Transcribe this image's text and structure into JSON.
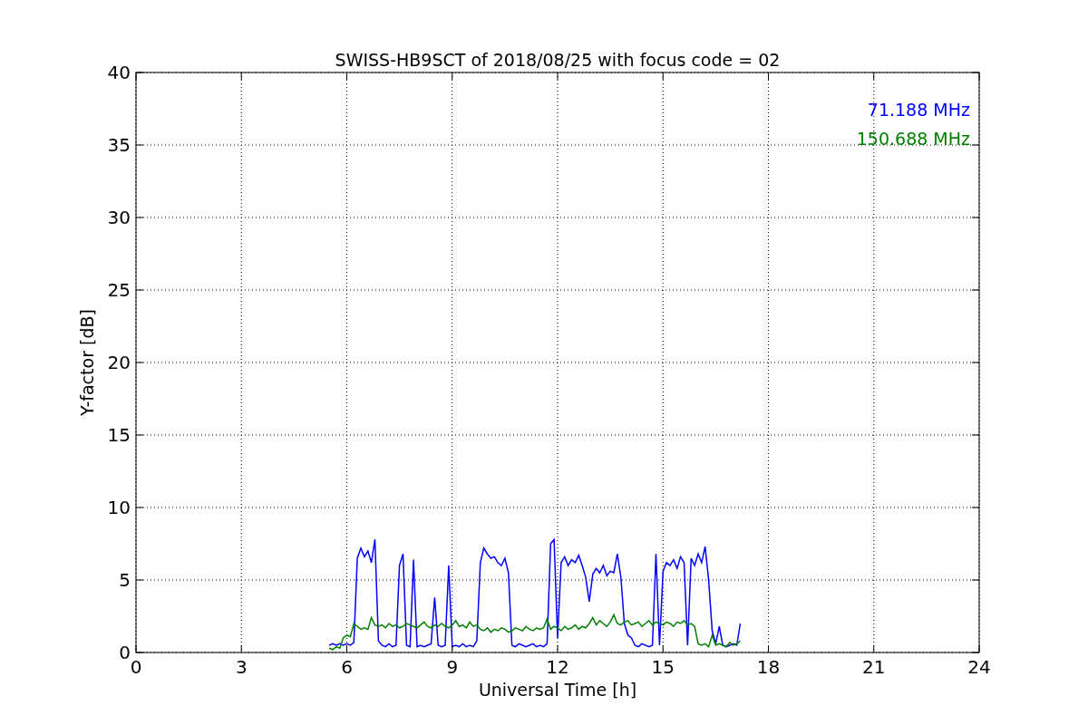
{
  "figure": {
    "chart_data": {
      "type": "line",
      "title": "SWISS-HB9SCT of 2018/08/25 with focus code = 02",
      "xlabel": "Universal Time [h]",
      "ylabel": "Y-factor [dB]",
      "xlim": [
        0,
        24
      ],
      "ylim": [
        0,
        40
      ],
      "xticks": [
        0,
        3,
        6,
        9,
        12,
        15,
        18,
        21,
        24
      ],
      "yticks": [
        0,
        5,
        10,
        15,
        20,
        25,
        30,
        35,
        40
      ],
      "grid": true,
      "x": [
        5.5,
        5.6,
        5.7,
        5.8,
        5.9,
        6.0,
        6.1,
        6.2,
        6.3,
        6.4,
        6.5,
        6.6,
        6.7,
        6.8,
        6.9,
        7.0,
        7.1,
        7.2,
        7.3,
        7.4,
        7.5,
        7.6,
        7.7,
        7.8,
        7.9,
        8.0,
        8.1,
        8.2,
        8.3,
        8.4,
        8.5,
        8.6,
        8.7,
        8.8,
        8.9,
        9.0,
        9.1,
        9.2,
        9.3,
        9.4,
        9.5,
        9.6,
        9.7,
        9.8,
        9.9,
        10.0,
        10.1,
        10.2,
        10.3,
        10.4,
        10.5,
        10.6,
        10.7,
        10.8,
        10.9,
        11.0,
        11.1,
        11.2,
        11.3,
        11.4,
        11.5,
        11.6,
        11.7,
        11.8,
        11.9,
        12.0,
        12.1,
        12.2,
        12.3,
        12.4,
        12.5,
        12.6,
        12.7,
        12.8,
        12.9,
        13.0,
        13.1,
        13.2,
        13.3,
        13.4,
        13.5,
        13.6,
        13.7,
        13.8,
        13.9,
        14.0,
        14.1,
        14.2,
        14.3,
        14.4,
        14.5,
        14.6,
        14.7,
        14.8,
        14.9,
        15.0,
        15.1,
        15.2,
        15.3,
        15.4,
        15.5,
        15.6,
        15.7,
        15.8,
        15.9,
        16.0,
        16.1,
        16.2,
        16.3,
        16.4,
        16.5,
        16.6,
        16.7,
        16.8,
        16.9,
        17.0,
        17.1,
        17.2
      ],
      "series": [
        {
          "name": "71.188 MHz",
          "color": "#0000ff",
          "values": [
            0.5,
            0.6,
            0.5,
            0.6,
            0.5,
            0.6,
            0.5,
            0.7,
            6.5,
            7.2,
            6.6,
            7.0,
            6.2,
            7.8,
            0.8,
            0.5,
            0.4,
            0.6,
            0.4,
            0.5,
            6.0,
            6.8,
            0.5,
            0.4,
            6.4,
            0.4,
            0.5,
            0.4,
            0.5,
            0.6,
            3.8,
            0.5,
            0.4,
            0.5,
            6.0,
            0.4,
            0.5,
            0.4,
            0.6,
            0.4,
            0.5,
            0.4,
            0.8,
            6.2,
            7.2,
            6.8,
            6.5,
            6.6,
            6.2,
            6.0,
            6.5,
            5.5,
            0.5,
            0.4,
            0.6,
            0.5,
            0.4,
            0.5,
            0.6,
            0.4,
            0.5,
            0.4,
            0.6,
            7.5,
            7.8,
            1.0,
            6.2,
            6.6,
            6.0,
            6.4,
            6.2,
            6.7,
            6.0,
            5.2,
            3.5,
            5.4,
            5.8,
            5.5,
            6.0,
            5.3,
            5.6,
            5.5,
            6.8,
            5.2,
            2.0,
            1.2,
            1.0,
            0.5,
            0.4,
            0.6,
            0.5,
            0.4,
            0.5,
            6.8,
            0.5,
            5.6,
            6.2,
            6.0,
            6.4,
            5.8,
            6.6,
            6.2,
            0.5,
            6.5,
            6.0,
            6.8,
            6.2,
            7.3,
            5.0,
            1.5,
            0.6,
            1.8,
            0.5,
            0.4,
            0.5,
            0.6,
            0.5,
            2.0
          ]
        },
        {
          "name": "150.688 MHz",
          "color": "#008000",
          "values": [
            0.3,
            0.2,
            0.4,
            0.3,
            1.0,
            1.2,
            1.1,
            2.0,
            1.8,
            1.6,
            1.7,
            1.6,
            2.4,
            1.9,
            1.8,
            1.9,
            1.7,
            2.0,
            1.8,
            1.9,
            1.7,
            1.8,
            2.0,
            1.9,
            1.8,
            1.7,
            1.9,
            2.1,
            1.8,
            1.7,
            1.9,
            1.8,
            2.0,
            1.8,
            1.7,
            1.9,
            2.2,
            1.8,
            1.9,
            1.7,
            2.1,
            1.8,
            1.9,
            1.6,
            1.5,
            1.7,
            1.4,
            1.6,
            1.5,
            1.7,
            1.6,
            1.4,
            1.5,
            1.7,
            1.6,
            1.5,
            1.8,
            1.6,
            1.5,
            1.7,
            1.6,
            1.7,
            2.3,
            1.6,
            1.8,
            1.7,
            1.5,
            1.8,
            1.6,
            1.7,
            1.9,
            1.6,
            1.8,
            1.7,
            2.0,
            2.4,
            1.9,
            2.2,
            2.0,
            1.8,
            2.1,
            2.6,
            2.0,
            1.9,
            2.1,
            2.2,
            1.9,
            2.0,
            2.1,
            1.8,
            2.0,
            2.2,
            1.9,
            2.1,
            2.0,
            1.9,
            2.1,
            2.0,
            1.8,
            2.1,
            2.0,
            2.2,
            1.9,
            2.0,
            1.8,
            0.6,
            0.5,
            0.6,
            0.4,
            1.2,
            0.5,
            0.6,
            0.5,
            0.4,
            0.7,
            0.5,
            0.6,
            0.8
          ]
        }
      ]
    }
  }
}
